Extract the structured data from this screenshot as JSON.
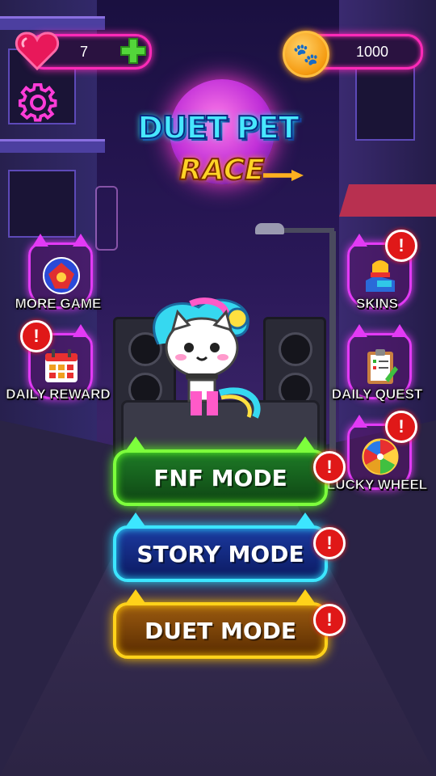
{
  "hud": {
    "lives": "7",
    "coins": "1000",
    "icons": {
      "lives": "heart-icon",
      "add": "plus-icon",
      "currency": "paw-coin-icon",
      "settings": "gear-icon"
    }
  },
  "title": {
    "line1": "DUET PET",
    "line2": "RACE"
  },
  "left_menu": [
    {
      "label": "MORE GAME",
      "icon": "more-games-icon",
      "alert": false
    },
    {
      "label": "DAILY REWARD",
      "icon": "calendar-icon",
      "alert": true
    }
  ],
  "right_menu": [
    {
      "label": "SKINS",
      "icon": "skins-icon",
      "alert": true
    },
    {
      "label": "DAILY QUEST",
      "icon": "clipboard-icon",
      "alert": false
    },
    {
      "label": "LUCKY WHEEL",
      "icon": "wheel-icon",
      "alert": true
    }
  ],
  "modes": [
    {
      "label": "FNF MODE",
      "alert": true
    },
    {
      "label": "STORY MODE",
      "alert": true
    },
    {
      "label": "DUET MODE",
      "alert": true
    }
  ],
  "alert_glyph": "!",
  "colors": {
    "neon_pink": "#ff2ab8",
    "neon_green": "#7dff3c",
    "neon_blue": "#3ce6ff",
    "neon_yellow": "#ffd21a",
    "alert_red": "#e01818"
  }
}
